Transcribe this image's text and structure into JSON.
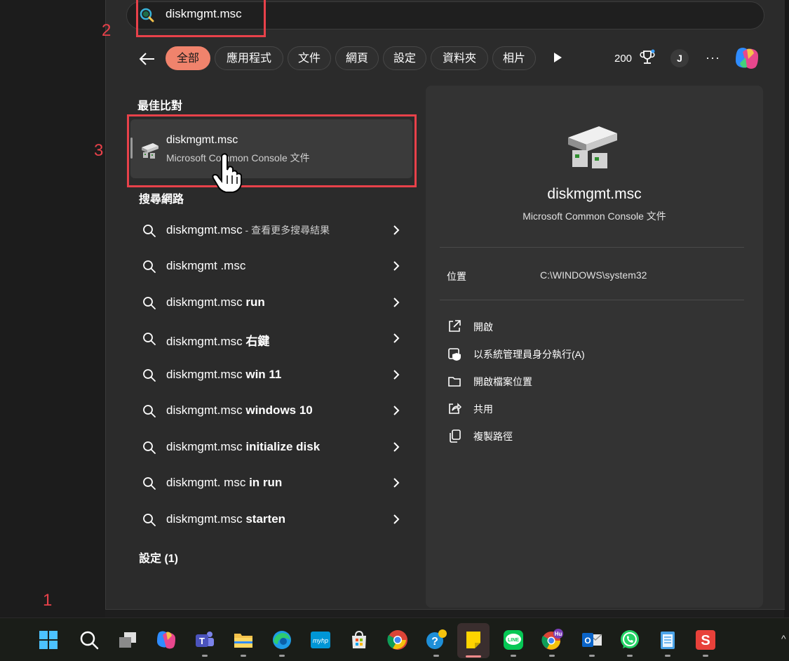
{
  "search": {
    "query": "diskmgmt.msc"
  },
  "filters": {
    "chips": [
      {
        "label": "全部",
        "active": true
      },
      {
        "label": "應用程式"
      },
      {
        "label": "文件"
      },
      {
        "label": "網頁"
      },
      {
        "label": "設定"
      },
      {
        "label": "資料夾"
      },
      {
        "label": "相片"
      }
    ],
    "points": "200",
    "avatar_initial": "J",
    "more_label": "···"
  },
  "annotations": {
    "one": "1",
    "two": "2",
    "three": "3"
  },
  "best_match": {
    "heading": "最佳比對",
    "title": "diskmgmt.msc",
    "subtitle": "Microsoft Common Console 文件"
  },
  "web": {
    "heading": "搜尋網路",
    "results": [
      {
        "prefix": "diskmgmt.msc",
        "bold": "",
        "suffix": " - 查看更多搜尋結果"
      },
      {
        "prefix": "diskmgmt .msc",
        "bold": "",
        "suffix": ""
      },
      {
        "prefix": "diskmgmt.msc ",
        "bold": "run",
        "suffix": ""
      },
      {
        "prefix": "diskmgmt.msc ",
        "bold": "右鍵",
        "suffix": ""
      },
      {
        "prefix": "diskmgmt.msc ",
        "bold": "win 11",
        "suffix": ""
      },
      {
        "prefix": "diskmgmt.msc ",
        "bold": "windows 10",
        "suffix": ""
      },
      {
        "prefix": "diskmgmt.msc ",
        "bold": "initialize disk",
        "suffix": ""
      },
      {
        "prefix": "diskmgmt. msc ",
        "bold": "in run",
        "suffix": ""
      },
      {
        "prefix": "diskmgmt.msc ",
        "bold": "starten",
        "suffix": ""
      }
    ]
  },
  "settings": {
    "heading": "設定 (1)"
  },
  "detail": {
    "title": "diskmgmt.msc",
    "subtitle": "Microsoft Common Console 文件",
    "location_label": "位置",
    "location_value": "C:\\WINDOWS\\system32",
    "actions": [
      {
        "label": "開啟",
        "icon": "open-external-icon"
      },
      {
        "label": "以系統管理員身分執行(A)",
        "icon": "run-as-admin-icon"
      },
      {
        "label": "開啟檔案位置",
        "icon": "folder-icon"
      },
      {
        "label": "共用",
        "icon": "share-icon"
      },
      {
        "label": "複製路徑",
        "icon": "copy-path-icon"
      }
    ]
  },
  "taskbar": {
    "apps": [
      "start",
      "search",
      "task-view",
      "copilot",
      "teams",
      "file-explorer",
      "edge",
      "myhp",
      "store",
      "chrome",
      "help",
      "sticky-notes",
      "line",
      "chrome-profile",
      "outlook",
      "whatsapp",
      "notepad",
      "wps"
    ],
    "chrome_profile_badge": "Hu"
  },
  "colors": {
    "accent_chip": "#f0836c",
    "annotation": "#e8414a",
    "panel": "#2b2b2b",
    "detail_pane": "#333333"
  }
}
